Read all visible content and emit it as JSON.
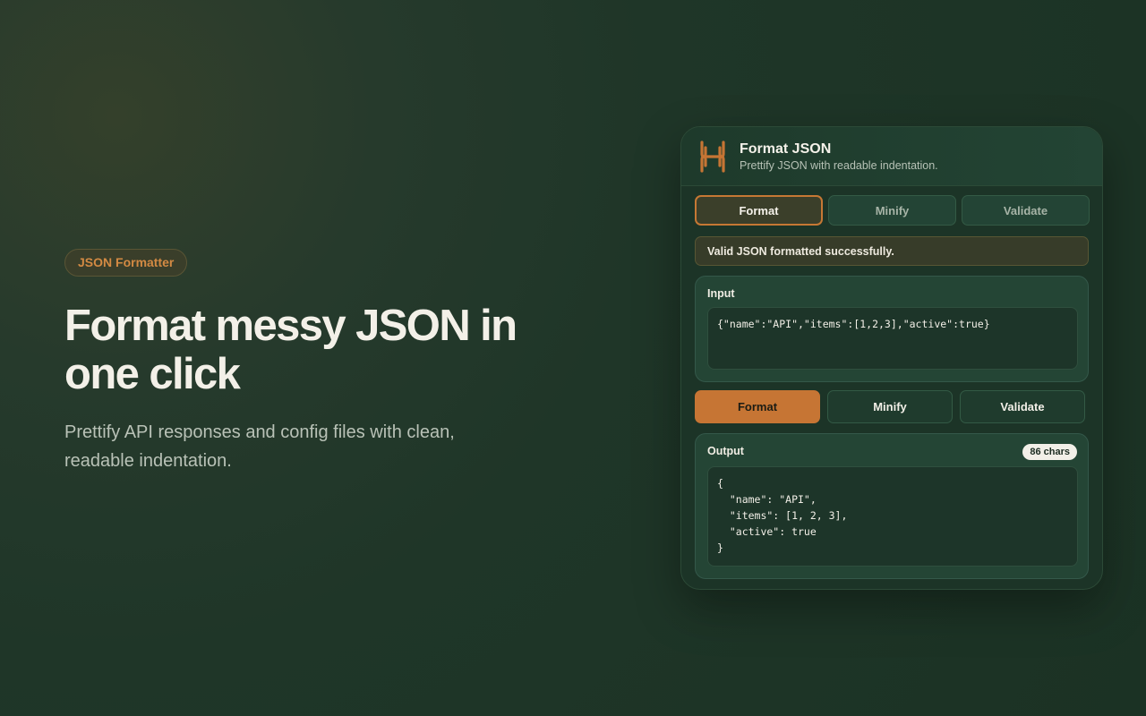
{
  "hero": {
    "badge": "JSON Formatter",
    "headline": "Format messy JSON in one click",
    "description": "Prettify API responses and config files with clean, readable indentation."
  },
  "tool": {
    "logo_icon": "h-letter-logo-icon",
    "title": "Format JSON",
    "subtitle": "Prettify JSON with readable indentation.",
    "tabs": [
      {
        "label": "Format",
        "active": true
      },
      {
        "label": "Minify",
        "active": false
      },
      {
        "label": "Validate",
        "active": false
      }
    ],
    "status_message": "Valid JSON formatted successfully.",
    "input": {
      "label": "Input",
      "value": "{\"name\":\"API\",\"items\":[1,2,3],\"active\":true}"
    },
    "actions": [
      {
        "label": "Format",
        "primary": true
      },
      {
        "label": "Minify",
        "primary": false
      },
      {
        "label": "Validate",
        "primary": false
      }
    ],
    "output": {
      "label": "Output",
      "char_count": "86 chars",
      "value": "{\n  \"name\": \"API\",\n  \"items\": [1, 2, 3],\n  \"active\": true\n}"
    }
  },
  "colors": {
    "accent": "#c67534",
    "background": "#1f3628",
    "card": "#1c3427"
  }
}
